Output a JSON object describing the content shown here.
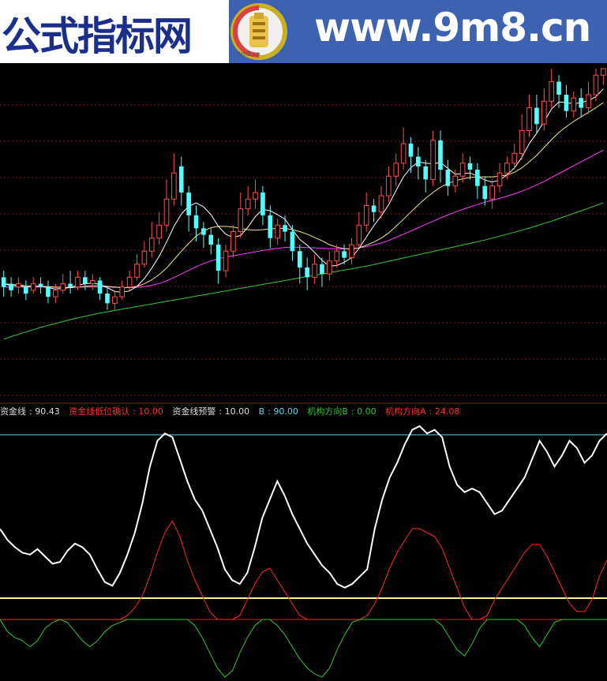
{
  "banner": {
    "title": "公式指标网",
    "url": "www.9m8.cn",
    "logo_text": "9m8.cn"
  },
  "colors": {
    "candle_up": "#ff4d4d",
    "candle_down": "#54ffff",
    "ma_fast": "#ffffff",
    "ma_mid": "#f0e68c",
    "ma_slow": "#ff3cff",
    "ma_long": "#35c935",
    "grid": "#7a1a1a",
    "zijinxian": "#ffffff",
    "red_line": "#ff2a2a",
    "green_line": "#2ec92e",
    "level_cyan": "#5ad6e8",
    "level_yellow": "#fff3a0",
    "level_red": "#d02020"
  },
  "legend": [
    {
      "label": "资金线",
      "value": "90.43",
      "color": "#dcdcdc"
    },
    {
      "label": "资金线低位确认",
      "value": "10.00",
      "color": "#ff3030"
    },
    {
      "label": "资金线预警",
      "value": "10.00",
      "color": "#dcdcdc"
    },
    {
      "label": "B",
      "value": "90.00",
      "color": "#5ad6e8"
    },
    {
      "label": "机构方向B",
      "value": "0.00",
      "color": "#2ec92e"
    },
    {
      "label": "机构方向A",
      "value": "24.08",
      "color": "#ff3030"
    }
  ],
  "chart_data": [
    {
      "type": "candlestick",
      "title": "",
      "ylim": [
        0,
        100
      ],
      "candles": [
        [
          36,
          33,
          38,
          30,
          "down"
        ],
        [
          34,
          32,
          36,
          30,
          "down"
        ],
        [
          33,
          34,
          36,
          31,
          "up"
        ],
        [
          33,
          31,
          35,
          29,
          "down"
        ],
        [
          32,
          34,
          36,
          31,
          "up"
        ],
        [
          34,
          33,
          36,
          31,
          "down"
        ],
        [
          33,
          30,
          35,
          28,
          "down"
        ],
        [
          30,
          32,
          34,
          28,
          "up"
        ],
        [
          32,
          34,
          37,
          31,
          "up"
        ],
        [
          34,
          33,
          38,
          31,
          "down"
        ],
        [
          33,
          36,
          38,
          32,
          "up"
        ],
        [
          36,
          34,
          38,
          32,
          "down"
        ],
        [
          34,
          35,
          37,
          32,
          "up"
        ],
        [
          35,
          31,
          36,
          29,
          "down"
        ],
        [
          31,
          28,
          33,
          26,
          "down"
        ],
        [
          28,
          30,
          32,
          26,
          "up"
        ],
        [
          30,
          33,
          35,
          29,
          "up"
        ],
        [
          33,
          36,
          38,
          32,
          "up"
        ],
        [
          36,
          40,
          43,
          35,
          "up"
        ],
        [
          40,
          44,
          47,
          39,
          "up"
        ],
        [
          44,
          48,
          53,
          42,
          "up"
        ],
        [
          48,
          52,
          56,
          46,
          "up"
        ],
        [
          52,
          60,
          66,
          50,
          "up"
        ],
        [
          60,
          68,
          74,
          58,
          "up"
        ],
        [
          70,
          62,
          73,
          58,
          "down"
        ],
        [
          62,
          55,
          64,
          50,
          "down"
        ],
        [
          55,
          51,
          58,
          47,
          "down"
        ],
        [
          51,
          49,
          53,
          45,
          "down"
        ],
        [
          49,
          46,
          51,
          43,
          "down"
        ],
        [
          46,
          38,
          48,
          34,
          "down"
        ],
        [
          38,
          44,
          46,
          36,
          "up"
        ],
        [
          44,
          50,
          52,
          42,
          "up"
        ],
        [
          50,
          57,
          62,
          48,
          "up"
        ],
        [
          57,
          60,
          64,
          55,
          "up"
        ],
        [
          60,
          62,
          66,
          57,
          "up"
        ],
        [
          62,
          55,
          64,
          52,
          "down"
        ],
        [
          55,
          48,
          58,
          45,
          "down"
        ],
        [
          48,
          52,
          54,
          46,
          "up"
        ],
        [
          52,
          50,
          55,
          47,
          "down"
        ],
        [
          50,
          44,
          52,
          41,
          "down"
        ],
        [
          44,
          39,
          46,
          34,
          "down"
        ],
        [
          39,
          36,
          42,
          32,
          "down"
        ],
        [
          36,
          40,
          43,
          34,
          "up"
        ],
        [
          40,
          37,
          42,
          33,
          "down"
        ],
        [
          37,
          41,
          44,
          35,
          "up"
        ],
        [
          41,
          44,
          46,
          39,
          "up"
        ],
        [
          44,
          42,
          46,
          40,
          "down"
        ],
        [
          42,
          46,
          48,
          40,
          "up"
        ],
        [
          46,
          52,
          56,
          45,
          "up"
        ],
        [
          52,
          58,
          62,
          50,
          "up"
        ],
        [
          58,
          56,
          60,
          53,
          "down"
        ],
        [
          56,
          61,
          64,
          54,
          "up"
        ],
        [
          61,
          67,
          70,
          59,
          "up"
        ],
        [
          67,
          71,
          74,
          64,
          "up"
        ],
        [
          71,
          77,
          82,
          69,
          "up"
        ],
        [
          77,
          73,
          79,
          68,
          "down"
        ],
        [
          73,
          70,
          76,
          66,
          "down"
        ],
        [
          70,
          66,
          72,
          62,
          "down"
        ],
        [
          66,
          78,
          81,
          64,
          "up"
        ],
        [
          78,
          69,
          81,
          65,
          "down"
        ],
        [
          69,
          64,
          72,
          61,
          "down"
        ],
        [
          64,
          67,
          69,
          62,
          "up"
        ],
        [
          67,
          71,
          74,
          65,
          "up"
        ],
        [
          71,
          69,
          73,
          66,
          "down"
        ],
        [
          69,
          64,
          71,
          60,
          "down"
        ],
        [
          64,
          60,
          67,
          58,
          "down"
        ],
        [
          60,
          64,
          66,
          57,
          "up"
        ],
        [
          64,
          68,
          71,
          62,
          "up"
        ],
        [
          68,
          71,
          73,
          66,
          "up"
        ],
        [
          71,
          74,
          77,
          69,
          "up"
        ],
        [
          74,
          81,
          86,
          72,
          "up"
        ],
        [
          81,
          88,
          92,
          79,
          "up"
        ],
        [
          88,
          83,
          92,
          80,
          "down"
        ],
        [
          83,
          90,
          94,
          81,
          "up"
        ],
        [
          90,
          96,
          100,
          88,
          "up"
        ],
        [
          96,
          92,
          98,
          88,
          "down"
        ],
        [
          92,
          87,
          95,
          85,
          "down"
        ],
        [
          87,
          91,
          93,
          85,
          "up"
        ],
        [
          91,
          88,
          94,
          85,
          "down"
        ],
        [
          88,
          92,
          96,
          86,
          "up"
        ],
        [
          92,
          98,
          100,
          90,
          "up"
        ],
        [
          98,
          100,
          100,
          95,
          "up"
        ]
      ],
      "ma_fast": [
        34,
        33.5,
        33.4,
        33,
        33.2,
        33.3,
        32.8,
        32.4,
        32.6,
        32.8,
        33.6,
        34,
        34.2,
        33.8,
        32.8,
        31.6,
        31.4,
        31.8,
        33.2,
        35.6,
        38.8,
        42.4,
        46.8,
        51.6,
        55.4,
        57.8,
        58.8,
        57.6,
        55.2,
        51.6,
        49.2,
        48.2,
        48.8,
        51.4,
        54.6,
        56.8,
        56.4,
        55.2,
        53.8,
        50.6,
        47.6,
        45.8,
        43.6,
        41.2,
        39.4,
        39.6,
        40.6,
        42,
        44.8,
        48.4,
        51.8,
        54.8,
        58.2,
        62.6,
        66.8,
        69.6,
        71.4,
        71,
        70.8,
        71.2,
        69.4,
        67.6,
        67.8,
        68,
        67,
        65.8,
        65.2,
        65.8,
        67.4,
        69.6,
        72.8,
        77,
        80.2,
        83.8,
        87.6,
        89.8,
        89.6,
        89.2,
        89.6,
        90.2,
        91.4,
        93.8
      ],
      "ma_mid": [
        34,
        33.8,
        33.6,
        33.4,
        33.3,
        33.2,
        33.1,
        33,
        32.9,
        32.8,
        33,
        33.2,
        33.4,
        33.4,
        33.2,
        33,
        32.8,
        32.8,
        33.2,
        34,
        35.2,
        36.8,
        38.8,
        41.4,
        44,
        46.4,
        48.6,
        50.2,
        51.2,
        51.6,
        51.6,
        51.4,
        51,
        50.6,
        50.4,
        50.6,
        50.8,
        51,
        51,
        50.6,
        50,
        49.2,
        48.2,
        47.2,
        46,
        45.2,
        44.8,
        44.6,
        45,
        45.8,
        46.8,
        48,
        49.6,
        51.6,
        53.8,
        56,
        58.2,
        60.2,
        62,
        63.6,
        64.8,
        65.6,
        66.2,
        66.6,
        66.8,
        66.8,
        66.8,
        67,
        67.4,
        68.2,
        69.6,
        71.4,
        73.4,
        75.8,
        78.2,
        80.4,
        82.2,
        83.8,
        85.2,
        86.6,
        88,
        89.6
      ],
      "ma_slow": [
        33,
        33,
        33,
        33,
        33,
        33,
        33,
        32.9,
        32.9,
        32.9,
        32.9,
        33,
        33,
        33,
        33,
        32.9,
        32.8,
        32.8,
        32.9,
        33.1,
        33.5,
        34.1,
        34.9,
        35.9,
        37,
        38.1,
        39.2,
        40.2,
        41,
        41.7,
        42.2,
        42.6,
        43,
        43.4,
        43.8,
        44.2,
        44.6,
        44.9,
        45.1,
        45.2,
        45.2,
        45.1,
        45,
        44.9,
        44.8,
        44.7,
        44.7,
        44.8,
        45,
        45.4,
        45.9,
        46.5,
        47.3,
        48.2,
        49.2,
        50.2,
        51.2,
        52.2,
        53.2,
        54.2,
        55.1,
        56,
        56.8,
        57.6,
        58.3,
        59,
        59.6,
        60.2,
        60.9,
        61.6,
        62.4,
        63.3,
        64.3,
        65.4,
        66.6,
        67.8,
        69,
        70.2,
        71.4,
        72.6,
        73.8,
        75
      ],
      "ma_long": [
        17,
        17.8,
        18.5,
        19.2,
        19.9,
        20.6,
        21.2,
        21.8,
        22.4,
        23,
        23.5,
        24,
        24.5,
        25,
        25.4,
        25.8,
        26.2,
        26.6,
        27,
        27.4,
        27.8,
        28.2,
        28.6,
        29,
        29.4,
        29.8,
        30.2,
        30.6,
        31,
        31.4,
        31.8,
        32.2,
        32.6,
        33,
        33.4,
        33.8,
        34.2,
        34.6,
        35,
        35.4,
        35.8,
        36.2,
        36.6,
        37,
        37.4,
        37.8,
        38.2,
        38.6,
        39,
        39.4,
        39.9,
        40.4,
        40.9,
        41.4,
        41.9,
        42.4,
        42.9,
        43.4,
        43.9,
        44.4,
        44.9,
        45.4,
        45.9,
        46.4,
        46.9,
        47.4,
        48,
        48.6,
        49.2,
        49.8,
        50.4,
        51.1,
        51.8,
        52.5,
        53.2,
        54,
        54.8,
        55.6,
        56.4,
        57.2,
        58,
        58.8
      ]
    },
    {
      "type": "line",
      "title": "",
      "ylim": [
        0,
        100
      ],
      "levels": [
        {
          "name": "B",
          "value": 90,
          "color": "#5ad6e8"
        },
        {
          "name": "资金线低位确认",
          "value": 10,
          "color": "#fff3a0"
        },
        {
          "name": "机构方向B",
          "value": 0,
          "color": "#d02020"
        }
      ],
      "series": [
        {
          "name": "资金线",
          "values": [
            44,
            38,
            34,
            31,
            30,
            33,
            29,
            25,
            26,
            32,
            36,
            34,
            30,
            22,
            15,
            13,
            20,
            30,
            42,
            58,
            78,
            92,
            96,
            94,
            82,
            70,
            60,
            54,
            44,
            34,
            22,
            16,
            14,
            20,
            34,
            50,
            60,
            70,
            62,
            52,
            44,
            36,
            30,
            24,
            20,
            14,
            12,
            14,
            18,
            22,
            44,
            60,
            72,
            80,
            90,
            98,
            100,
            96,
            98,
            94,
            78,
            68,
            64,
            66,
            64,
            58,
            52,
            54,
            60,
            66,
            72,
            82,
            92,
            86,
            78,
            84,
            92,
            88,
            80,
            84,
            92,
            96
          ]
        },
        {
          "name": "机构方向A",
          "values": [
            0,
            0,
            0,
            0,
            0,
            0,
            0,
            0,
            0,
            0,
            0,
            0,
            0,
            0,
            0,
            0,
            0,
            2,
            6,
            12,
            22,
            34,
            44,
            50,
            42,
            30,
            20,
            12,
            4,
            0,
            0,
            0,
            2,
            10,
            18,
            24,
            26,
            20,
            14,
            8,
            2,
            0,
            0,
            0,
            0,
            0,
            0,
            0,
            0,
            2,
            8,
            16,
            26,
            34,
            40,
            46,
            46,
            44,
            42,
            36,
            26,
            16,
            6,
            0,
            0,
            2,
            10,
            16,
            22,
            28,
            34,
            38,
            38,
            32,
            24,
            16,
            8,
            4,
            4,
            10,
            22,
            30
          ]
        },
        {
          "name": "机构方向B",
          "values": [
            0,
            -8,
            -12,
            -14,
            -18,
            -14,
            -6,
            -2,
            0,
            -2,
            -8,
            -14,
            -18,
            -14,
            -8,
            -4,
            -2,
            0,
            0,
            0,
            0,
            0,
            0,
            0,
            0,
            0,
            -4,
            -12,
            -22,
            -32,
            -38,
            -34,
            -22,
            -12,
            -4,
            0,
            0,
            -4,
            -10,
            -18,
            -26,
            -32,
            -36,
            -38,
            -32,
            -20,
            -10,
            -2,
            0,
            0,
            0,
            0,
            0,
            0,
            0,
            0,
            0,
            0,
            0,
            -4,
            -12,
            -20,
            -24,
            -16,
            -6,
            0,
            0,
            0,
            0,
            0,
            -4,
            -12,
            -18,
            -10,
            -2,
            0,
            0,
            0,
            0,
            0,
            0,
            0
          ]
        }
      ]
    }
  ]
}
